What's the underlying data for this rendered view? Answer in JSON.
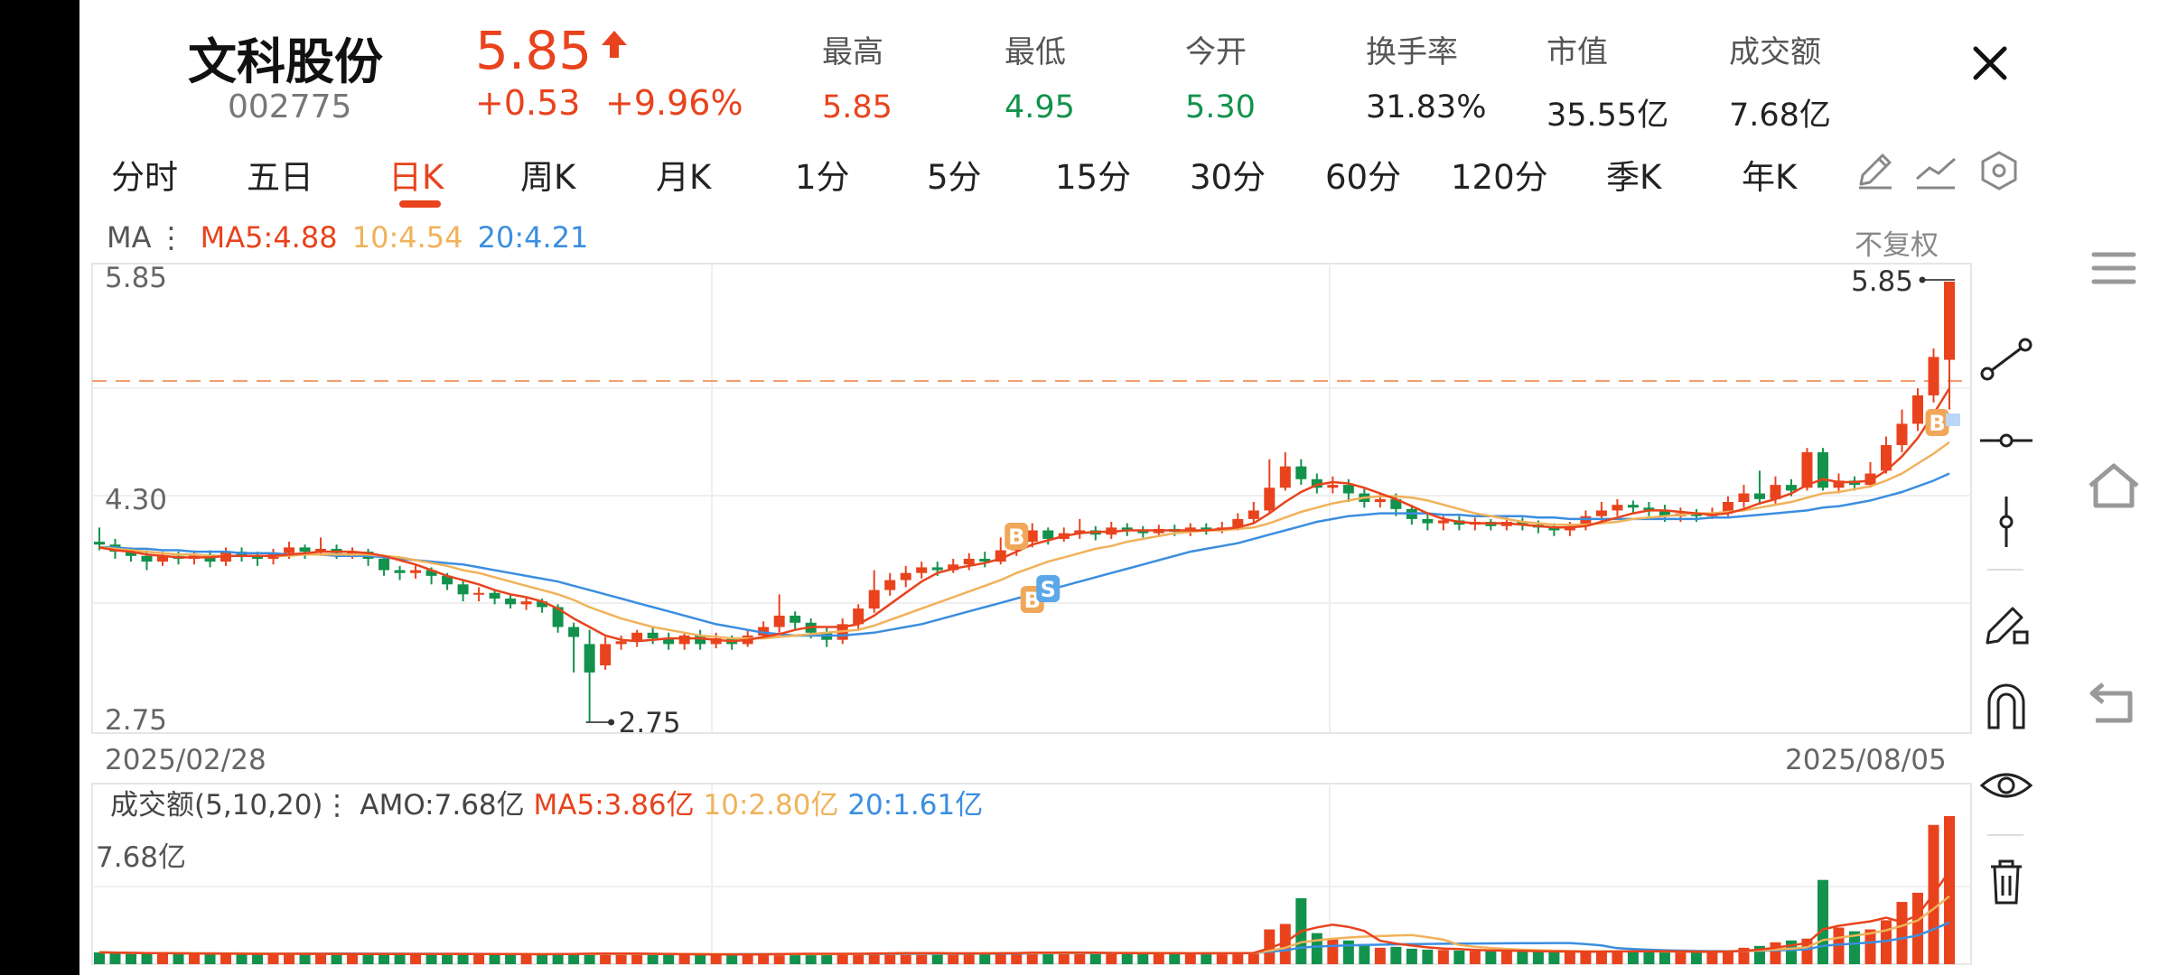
{
  "header": {
    "name": "文科股份",
    "code": "002775",
    "price": "5.85",
    "change": "+0.53",
    "change_pct": "+9.96%",
    "stats": [
      {
        "label": "最高",
        "value": "5.85",
        "color": "red"
      },
      {
        "label": "最低",
        "value": "4.95",
        "color": "green"
      },
      {
        "label": "今开",
        "value": "5.30",
        "color": "green"
      },
      {
        "label": "换手率",
        "value": "31.83%",
        "color": "dark"
      },
      {
        "label": "市值",
        "value": "35.55亿",
        "color": "dark"
      },
      {
        "label": "成交额",
        "value": "7.68亿",
        "color": "dark"
      }
    ]
  },
  "tabs": [
    "分时",
    "五日",
    "日K",
    "周K",
    "月K",
    "1分",
    "5分",
    "15分",
    "30分",
    "60分",
    "120分",
    "季K",
    "年K"
  ],
  "active_tab": "日K",
  "ma_legend": {
    "prefix": "MA",
    "ma5": "MA5:4.88",
    "ma10": "10:4.54",
    "ma20": "20:4.21"
  },
  "adjust_label": "不复权",
  "price_axis": {
    "top": "5.85",
    "mid": "4.30",
    "bottom": "2.75"
  },
  "annotations": {
    "high": "5.85",
    "low": "2.75",
    "buy": "B",
    "sell": "S"
  },
  "date_range": {
    "start": "2025/02/28",
    "end": "2025/08/05"
  },
  "volume_legend": {
    "prefix": "成交额(5,10,20)",
    "amo": "AMO:7.68亿",
    "ma5": "MA5:3.86亿",
    "ma10": "10:2.80亿",
    "ma20": "20:1.61亿"
  },
  "volume_axis": {
    "top": "7.68亿"
  },
  "colors": {
    "up": "#e8431d",
    "down": "#12924c",
    "ma5": "#e8431d",
    "ma10": "#f0b25a",
    "ma20": "#3b8ee0",
    "accent": "#e8431d"
  },
  "icons": {
    "toolbar": [
      "pencil-icon",
      "line-chart-icon",
      "settings-hexagon-icon"
    ],
    "drawing": [
      "segment-line-icon",
      "horizontal-line-icon",
      "vertical-line-icon",
      "draw-pen-icon",
      "magnet-icon",
      "eye-icon",
      "trash-icon"
    ],
    "nav": [
      "menu-icon",
      "home-icon",
      "back-icon"
    ]
  },
  "chart_data": {
    "type": "candlestick",
    "x_range": [
      "2025/02/28",
      "2025/08/05"
    ],
    "ylim": [
      2.75,
      5.85
    ],
    "candles": [
      [
        4.02,
        4.0,
        3.96,
        4.12
      ],
      [
        4.0,
        3.95,
        3.9,
        4.04
      ],
      [
        3.95,
        3.92,
        3.88,
        3.98
      ],
      [
        3.92,
        3.88,
        3.82,
        3.96
      ],
      [
        3.88,
        3.92,
        3.85,
        3.95
      ],
      [
        3.92,
        3.9,
        3.86,
        3.95
      ],
      [
        3.9,
        3.93,
        3.86,
        3.96
      ],
      [
        3.93,
        3.88,
        3.84,
        3.96
      ],
      [
        3.88,
        3.95,
        3.85,
        3.98
      ],
      [
        3.95,
        3.92,
        3.88,
        3.98
      ],
      [
        3.92,
        3.9,
        3.85,
        3.95
      ],
      [
        3.9,
        3.94,
        3.86,
        3.97
      ],
      [
        3.94,
        3.98,
        3.9,
        4.02
      ],
      [
        3.98,
        3.95,
        3.9,
        4.0
      ],
      [
        3.95,
        3.97,
        3.92,
        4.05
      ],
      [
        3.97,
        3.94,
        3.9,
        4.0
      ],
      [
        3.94,
        3.95,
        3.9,
        3.98
      ],
      [
        3.95,
        3.9,
        3.85,
        3.97
      ],
      [
        3.9,
        3.82,
        3.78,
        3.92
      ],
      [
        3.82,
        3.8,
        3.75,
        3.85
      ],
      [
        3.8,
        3.82,
        3.76,
        3.86
      ],
      [
        3.82,
        3.78,
        3.72,
        3.84
      ],
      [
        3.78,
        3.72,
        3.68,
        3.8
      ],
      [
        3.72,
        3.65,
        3.6,
        3.75
      ],
      [
        3.65,
        3.66,
        3.6,
        3.7
      ],
      [
        3.66,
        3.62,
        3.58,
        3.68
      ],
      [
        3.62,
        3.58,
        3.55,
        3.65
      ],
      [
        3.58,
        3.6,
        3.54,
        3.63
      ],
      [
        3.6,
        3.56,
        3.52,
        3.62
      ],
      [
        3.56,
        3.42,
        3.38,
        3.58
      ],
      [
        3.42,
        3.35,
        3.1,
        3.45
      ],
      [
        3.3,
        3.1,
        2.75,
        3.4
      ],
      [
        3.15,
        3.3,
        3.12,
        3.35
      ],
      [
        3.3,
        3.32,
        3.26,
        3.36
      ],
      [
        3.32,
        3.38,
        3.28,
        3.4
      ],
      [
        3.38,
        3.34,
        3.3,
        3.42
      ],
      [
        3.34,
        3.3,
        3.26,
        3.38
      ],
      [
        3.3,
        3.36,
        3.26,
        3.38
      ],
      [
        3.36,
        3.3,
        3.26,
        3.4
      ],
      [
        3.3,
        3.34,
        3.27,
        3.38
      ],
      [
        3.34,
        3.3,
        3.26,
        3.36
      ],
      [
        3.3,
        3.36,
        3.28,
        3.4
      ],
      [
        3.36,
        3.42,
        3.34,
        3.46
      ],
      [
        3.42,
        3.5,
        3.38,
        3.65
      ],
      [
        3.5,
        3.45,
        3.4,
        3.53
      ],
      [
        3.45,
        3.38,
        3.34,
        3.48
      ],
      [
        3.38,
        3.33,
        3.28,
        3.42
      ],
      [
        3.33,
        3.44,
        3.3,
        3.48
      ],
      [
        3.44,
        3.55,
        3.4,
        3.58
      ],
      [
        3.55,
        3.68,
        3.52,
        3.82
      ],
      [
        3.68,
        3.75,
        3.64,
        3.8
      ],
      [
        3.75,
        3.8,
        3.7,
        3.85
      ],
      [
        3.8,
        3.84,
        3.76,
        3.88
      ],
      [
        3.84,
        3.82,
        3.78,
        3.88
      ],
      [
        3.82,
        3.86,
        3.8,
        3.9
      ],
      [
        3.86,
        3.9,
        3.82,
        3.94
      ],
      [
        3.9,
        3.88,
        3.84,
        3.95
      ],
      [
        3.88,
        3.96,
        3.86,
        4.05
      ],
      [
        3.96,
        4.02,
        3.92,
        4.08
      ],
      [
        4.02,
        4.1,
        3.98,
        4.15
      ],
      [
        4.1,
        4.04,
        4.0,
        4.12
      ],
      [
        4.04,
        4.08,
        4.02,
        4.12
      ],
      [
        4.08,
        4.1,
        4.04,
        4.18
      ],
      [
        4.1,
        4.07,
        4.03,
        4.13
      ],
      [
        4.07,
        4.12,
        4.04,
        4.16
      ],
      [
        4.12,
        4.1,
        4.06,
        4.15
      ],
      [
        4.1,
        4.08,
        4.05,
        4.13
      ],
      [
        4.08,
        4.11,
        4.06,
        4.14
      ],
      [
        4.11,
        4.09,
        4.06,
        4.14
      ],
      [
        4.09,
        4.12,
        4.06,
        4.15
      ],
      [
        4.12,
        4.1,
        4.07,
        4.15
      ],
      [
        4.1,
        4.12,
        4.08,
        4.16
      ],
      [
        4.12,
        4.18,
        4.1,
        4.22
      ],
      [
        4.18,
        4.24,
        4.15,
        4.3
      ],
      [
        4.24,
        4.4,
        4.22,
        4.6
      ],
      [
        4.4,
        4.55,
        4.38,
        4.65
      ],
      [
        4.55,
        4.46,
        4.42,
        4.6
      ],
      [
        4.46,
        4.4,
        4.36,
        4.5
      ],
      [
        4.4,
        4.42,
        4.36,
        4.48
      ],
      [
        4.42,
        4.36,
        4.3,
        4.46
      ],
      [
        4.36,
        4.3,
        4.26,
        4.4
      ],
      [
        4.3,
        4.32,
        4.26,
        4.36
      ],
      [
        4.32,
        4.25,
        4.2,
        4.36
      ],
      [
        4.25,
        4.18,
        4.14,
        4.28
      ],
      [
        4.18,
        4.15,
        4.1,
        4.22
      ],
      [
        4.15,
        4.17,
        4.1,
        4.2
      ],
      [
        4.17,
        4.14,
        4.1,
        4.2
      ],
      [
        4.14,
        4.16,
        4.1,
        4.19
      ],
      [
        4.16,
        4.13,
        4.1,
        4.18
      ],
      [
        4.13,
        4.16,
        4.1,
        4.2
      ],
      [
        4.16,
        4.14,
        4.1,
        4.19
      ],
      [
        4.14,
        4.12,
        4.08,
        4.17
      ],
      [
        4.12,
        4.1,
        4.06,
        4.15
      ],
      [
        4.1,
        4.13,
        4.06,
        4.16
      ],
      [
        4.13,
        4.2,
        4.1,
        4.24
      ],
      [
        4.2,
        4.24,
        4.16,
        4.3
      ],
      [
        4.24,
        4.28,
        4.2,
        4.32
      ],
      [
        4.28,
        4.26,
        4.22,
        4.31
      ],
      [
        4.26,
        4.24,
        4.2,
        4.3
      ],
      [
        4.24,
        4.2,
        4.16,
        4.28
      ],
      [
        4.2,
        4.22,
        4.16,
        4.26
      ],
      [
        4.22,
        4.2,
        4.16,
        4.25
      ],
      [
        4.2,
        4.22,
        4.18,
        4.26
      ],
      [
        4.22,
        4.3,
        4.2,
        4.34
      ],
      [
        4.3,
        4.36,
        4.26,
        4.42
      ],
      [
        4.36,
        4.32,
        4.28,
        4.52
      ],
      [
        4.32,
        4.42,
        4.28,
        4.48
      ],
      [
        4.42,
        4.38,
        4.34,
        4.46
      ],
      [
        4.4,
        4.65,
        4.38,
        4.68
      ],
      [
        4.65,
        4.4,
        4.38,
        4.68
      ],
      [
        4.4,
        4.45,
        4.36,
        4.5
      ],
      [
        4.45,
        4.42,
        4.38,
        4.48
      ],
      [
        4.42,
        4.5,
        4.4,
        4.58
      ],
      [
        4.52,
        4.7,
        4.5,
        4.76
      ],
      [
        4.7,
        4.85,
        4.65,
        4.95
      ],
      [
        4.85,
        5.05,
        4.8,
        5.1
      ],
      [
        5.05,
        5.32,
        5.0,
        5.38
      ],
      [
        5.3,
        5.85,
        4.95,
        5.85
      ]
    ],
    "ma5": [
      3.98,
      3.96,
      3.95,
      3.93,
      3.92,
      3.91,
      3.91,
      3.91,
      3.92,
      3.92,
      3.92,
      3.92,
      3.93,
      3.94,
      3.95,
      3.95,
      3.95,
      3.94,
      3.92,
      3.89,
      3.86,
      3.82,
      3.78,
      3.75,
      3.72,
      3.68,
      3.65,
      3.63,
      3.6,
      3.55,
      3.48,
      3.42,
      3.36,
      3.33,
      3.32,
      3.33,
      3.34,
      3.34,
      3.34,
      3.33,
      3.32,
      3.33,
      3.35,
      3.37,
      3.4,
      3.42,
      3.42,
      3.42,
      3.44,
      3.5,
      3.58,
      3.66,
      3.74,
      3.8,
      3.83,
      3.85,
      3.87,
      3.9,
      3.95,
      4.0,
      4.03,
      4.06,
      4.08,
      4.09,
      4.09,
      4.1,
      4.1,
      4.1,
      4.1,
      4.1,
      4.1,
      4.11,
      4.12,
      4.15,
      4.22,
      4.3,
      4.37,
      4.42,
      4.44,
      4.43,
      4.4,
      4.36,
      4.32,
      4.27,
      4.22,
      4.18,
      4.16,
      4.15,
      4.15,
      4.15,
      4.14,
      4.13,
      4.12,
      4.12,
      4.13,
      4.16,
      4.19,
      4.22,
      4.24,
      4.24,
      4.23,
      4.22,
      4.21,
      4.22,
      4.25,
      4.29,
      4.32,
      4.36,
      4.42,
      4.46,
      4.44,
      4.44,
      4.45,
      4.52,
      4.62,
      4.75,
      4.92,
      5.1
    ],
    "ma10": [
      3.98,
      3.97,
      3.96,
      3.95,
      3.94,
      3.93,
      3.93,
      3.92,
      3.92,
      3.92,
      3.92,
      3.92,
      3.92,
      3.93,
      3.93,
      3.93,
      3.93,
      3.93,
      3.92,
      3.91,
      3.89,
      3.87,
      3.85,
      3.82,
      3.8,
      3.77,
      3.74,
      3.71,
      3.68,
      3.65,
      3.61,
      3.56,
      3.52,
      3.48,
      3.45,
      3.42,
      3.4,
      3.38,
      3.36,
      3.35,
      3.34,
      3.34,
      3.34,
      3.35,
      3.36,
      3.37,
      3.38,
      3.39,
      3.4,
      3.43,
      3.47,
      3.51,
      3.55,
      3.59,
      3.63,
      3.67,
      3.71,
      3.75,
      3.8,
      3.84,
      3.88,
      3.91,
      3.94,
      3.97,
      3.99,
      4.02,
      4.04,
      4.06,
      4.08,
      4.09,
      4.1,
      4.1,
      4.11,
      4.12,
      4.15,
      4.19,
      4.23,
      4.26,
      4.29,
      4.31,
      4.33,
      4.34,
      4.34,
      4.33,
      4.31,
      4.28,
      4.25,
      4.22,
      4.2,
      4.18,
      4.16,
      4.15,
      4.14,
      4.14,
      4.14,
      4.15,
      4.16,
      4.18,
      4.19,
      4.2,
      4.21,
      4.22,
      4.22,
      4.23,
      4.24,
      4.26,
      4.28,
      4.3,
      4.33,
      4.36,
      4.37,
      4.39,
      4.41,
      4.45,
      4.5,
      4.57,
      4.64,
      4.72
    ],
    "ma20": [
      3.98,
      3.98,
      3.97,
      3.97,
      3.96,
      3.96,
      3.95,
      3.95,
      3.95,
      3.94,
      3.94,
      3.94,
      3.93,
      3.93,
      3.93,
      3.92,
      3.92,
      3.92,
      3.91,
      3.9,
      3.89,
      3.88,
      3.87,
      3.86,
      3.84,
      3.82,
      3.8,
      3.78,
      3.76,
      3.74,
      3.71,
      3.68,
      3.65,
      3.62,
      3.59,
      3.56,
      3.53,
      3.5,
      3.47,
      3.44,
      3.42,
      3.4,
      3.38,
      3.37,
      3.36,
      3.36,
      3.36,
      3.36,
      3.37,
      3.38,
      3.4,
      3.42,
      3.44,
      3.47,
      3.5,
      3.53,
      3.56,
      3.59,
      3.62,
      3.65,
      3.68,
      3.71,
      3.74,
      3.77,
      3.8,
      3.83,
      3.86,
      3.89,
      3.92,
      3.95,
      3.97,
      3.99,
      4.01,
      4.04,
      4.07,
      4.1,
      4.13,
      4.16,
      4.18,
      4.2,
      4.21,
      4.22,
      4.22,
      4.22,
      4.22,
      4.21,
      4.21,
      4.2,
      4.2,
      4.2,
      4.2,
      4.19,
      4.19,
      4.18,
      4.18,
      4.18,
      4.18,
      4.18,
      4.18,
      4.18,
      4.18,
      4.18,
      4.19,
      4.19,
      4.2,
      4.21,
      4.22,
      4.23,
      4.24,
      4.26,
      4.27,
      4.29,
      4.31,
      4.34,
      4.37,
      4.41,
      4.45,
      4.5
    ],
    "volume": {
      "ylim": [
        0,
        7.68
      ],
      "unit": "亿",
      "values": [
        0.25,
        0.22,
        0.2,
        0.18,
        0.2,
        0.18,
        0.17,
        0.16,
        0.18,
        0.17,
        0.16,
        0.17,
        0.18,
        0.16,
        0.17,
        0.16,
        0.15,
        0.16,
        0.18,
        0.17,
        0.16,
        0.15,
        0.17,
        0.16,
        0.15,
        0.16,
        0.15,
        0.14,
        0.15,
        0.18,
        0.2,
        0.22,
        0.18,
        0.16,
        0.15,
        0.14,
        0.15,
        0.14,
        0.13,
        0.14,
        0.13,
        0.15,
        0.17,
        0.2,
        0.18,
        0.16,
        0.15,
        0.17,
        0.2,
        0.25,
        0.22,
        0.2,
        0.19,
        0.18,
        0.2,
        0.21,
        0.19,
        0.22,
        0.25,
        0.28,
        0.24,
        0.22,
        0.21,
        0.2,
        0.22,
        0.2,
        0.19,
        0.2,
        0.19,
        0.2,
        0.2,
        0.21,
        0.22,
        0.25,
        1.5,
        1.8,
        3.2,
        1.3,
        1.0,
        0.9,
        0.7,
        0.5,
        0.55,
        0.45,
        0.4,
        0.38,
        0.35,
        0.33,
        0.32,
        0.34,
        0.3,
        0.28,
        0.27,
        0.28,
        0.3,
        0.32,
        0.33,
        0.31,
        0.3,
        0.28,
        0.28,
        0.27,
        0.28,
        0.35,
        0.5,
        0.6,
        0.8,
        0.9,
        1.0,
        4.2,
        1.6,
        1.4,
        1.5,
        2.0,
        3.0,
        3.5,
        7.2,
        7.68
      ],
      "ma5_last": 3.86,
      "ma10_last": 2.8,
      "ma20_last": 1.61
    }
  }
}
